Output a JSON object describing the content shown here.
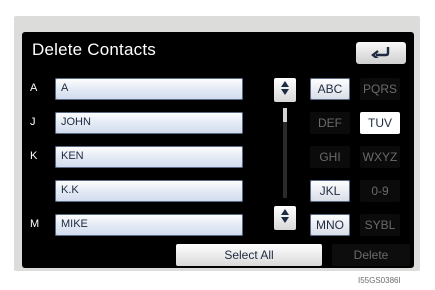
{
  "screen": {
    "title": "Delete Contacts",
    "back_icon": "back-arrow"
  },
  "contacts": [
    {
      "initial": "A",
      "name": "A"
    },
    {
      "initial": "J",
      "name": "JOHN"
    },
    {
      "initial": "K",
      "name": "KEN"
    },
    {
      "initial": "",
      "name": "K.K"
    },
    {
      "initial": "M",
      "name": "MIKE"
    }
  ],
  "index_keys": [
    {
      "label": "ABC",
      "state": "active"
    },
    {
      "label": "PQRS",
      "state": "dim"
    },
    {
      "label": "DEF",
      "state": "dim"
    },
    {
      "label": "TUV",
      "state": "selected"
    },
    {
      "label": "GHI",
      "state": "dim"
    },
    {
      "label": "WXYZ",
      "state": "dim"
    },
    {
      "label": "JKL",
      "state": "active"
    },
    {
      "label": "0-9",
      "state": "dim"
    },
    {
      "label": "MNO",
      "state": "active"
    },
    {
      "label": "SYBL",
      "state": "dim"
    }
  ],
  "scroll": {
    "up_icon": "scroll-up-icon",
    "down_icon": "scroll-down-icon"
  },
  "actions": {
    "select_all": "Select All",
    "delete": "Delete"
  },
  "footer_code": "I55GS0386I"
}
